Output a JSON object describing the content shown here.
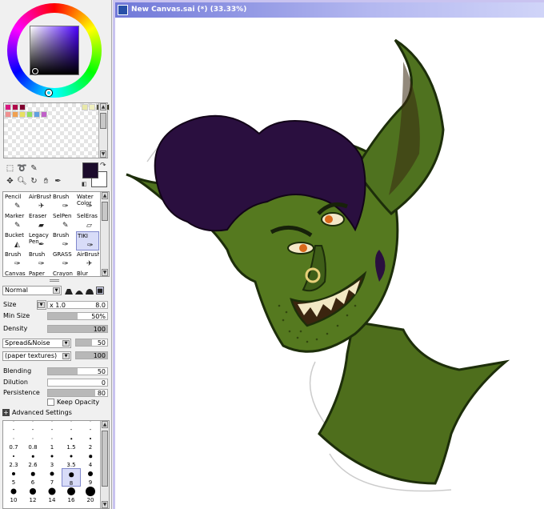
{
  "window": {
    "title": "New Canvas.sai (*) (33.33%)"
  },
  "color": {
    "foreground": "#1c0c2c",
    "background": "#ffffff"
  },
  "swatches": [
    "#d81880",
    "#b00848",
    "#800030",
    "#e8e8a8",
    "#f0f0c0",
    "#505040",
    "#282818",
    "#f09090",
    "#f0a050",
    "#e8e060",
    "#90e060",
    "#60a0e0",
    "#c060c8"
  ],
  "tools": [
    {
      "label": "Pencil",
      "icon": "pencil-icon"
    },
    {
      "label": "AirBrush",
      "icon": "airbrush-icon"
    },
    {
      "label": "Brush",
      "icon": "brush-icon"
    },
    {
      "label": "Water Color",
      "icon": "watercolor-icon"
    },
    {
      "label": "Marker",
      "icon": "marker-icon"
    },
    {
      "label": "Eraser",
      "icon": "eraser-icon"
    },
    {
      "label": "SelPen",
      "icon": "selpen-icon"
    },
    {
      "label": "SelEras",
      "icon": "seleras-icon"
    },
    {
      "label": "Bucket",
      "icon": "bucket-icon"
    },
    {
      "label": "Legacy Pen",
      "icon": "legacy-pen-icon"
    },
    {
      "label": "Brush",
      "icon": "brush-icon"
    },
    {
      "label": "TIKI",
      "icon": "brush-icon",
      "selected": true
    },
    {
      "label": "Brush",
      "icon": "brush-icon"
    },
    {
      "label": "Brush",
      "icon": "brush-icon"
    },
    {
      "label": "GRASS",
      "icon": "brush-icon"
    },
    {
      "label": "AirBrush",
      "icon": "airbrush-icon"
    },
    {
      "label": "Canvas",
      "icon": "brush-icon"
    },
    {
      "label": "Paper",
      "icon": "brush-icon"
    },
    {
      "label": "Crayon",
      "icon": "crayon-icon"
    },
    {
      "label": "Blur",
      "icon": "blur-icon"
    }
  ],
  "brush": {
    "mode": "Normal",
    "size_label": "Size",
    "size_multiplier": "x 1.0",
    "size_value": "8.0",
    "min_size_label": "Min Size",
    "min_size_value": "50%",
    "min_size_level": 0.5,
    "density_label": "Density",
    "density_value": "100",
    "density_level": 1.0,
    "texture1": "Spread&Noise",
    "texture1_value": "50",
    "texture1_level": 0.5,
    "texture2": "(paper textures)",
    "texture2_value": "100",
    "texture2_level": 1.0,
    "blending_label": "Blending",
    "blending_value": "50",
    "blending_level": 0.5,
    "dilution_label": "Dilution",
    "dilution_value": "0",
    "dilution_level": 0.0,
    "persistence_label": "Persistence",
    "persistence_value": "80",
    "persistence_level": 0.8,
    "keep_opacity_label": "Keep Opacity",
    "keep_opacity_checked": false
  },
  "advanced": {
    "label": "Advanced Settings"
  },
  "sizes": [
    [
      "-",
      "-",
      "-",
      "-",
      "-"
    ],
    [
      "0.7",
      "0.8",
      "1",
      "1.5",
      "2"
    ],
    [
      "2.3",
      "2.6",
      "3",
      "3.5",
      "4"
    ],
    [
      "5",
      "6",
      "7",
      "8",
      "9"
    ],
    [
      "10",
      "12",
      "14",
      "16",
      "20"
    ]
  ],
  "selected_size": "8"
}
